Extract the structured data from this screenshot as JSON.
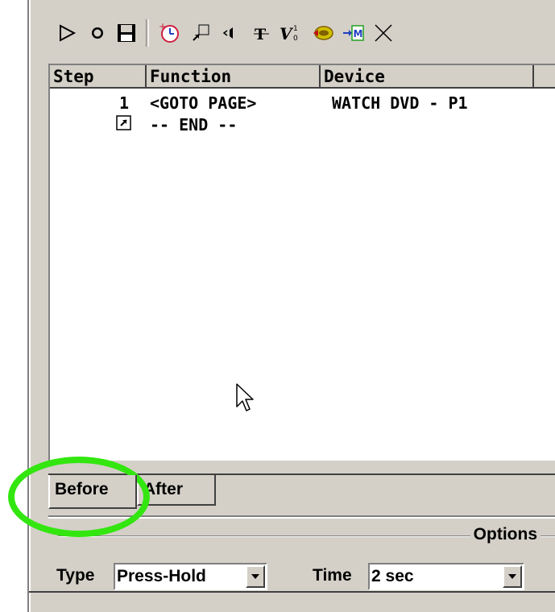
{
  "toolbar": {
    "buttons": [
      "play-icon",
      "record-icon",
      "save-icon",
      "add-timer-icon",
      "goto-page-icon",
      "speaker-icon",
      "text-icon",
      "variable-icon",
      "macro-icon",
      "insert-macro-icon",
      "delete-icon"
    ]
  },
  "grid": {
    "headers": [
      "Step",
      "Function",
      "Device"
    ],
    "rows": [
      {
        "step": "1",
        "function": "<GOTO PAGE>",
        "device": "WATCH DVD - P1"
      },
      {
        "step": "",
        "function": "-- END --",
        "device": ""
      }
    ]
  },
  "tabs": {
    "before": "Before",
    "after": "After"
  },
  "options": {
    "group_label": "Options",
    "type_label": "Type",
    "type_value": "Press-Hold",
    "time_label": "Time",
    "time_value": "2 sec"
  },
  "colors": {
    "highlight_ring": "#33e60f",
    "panel": "#d4d0c8"
  }
}
